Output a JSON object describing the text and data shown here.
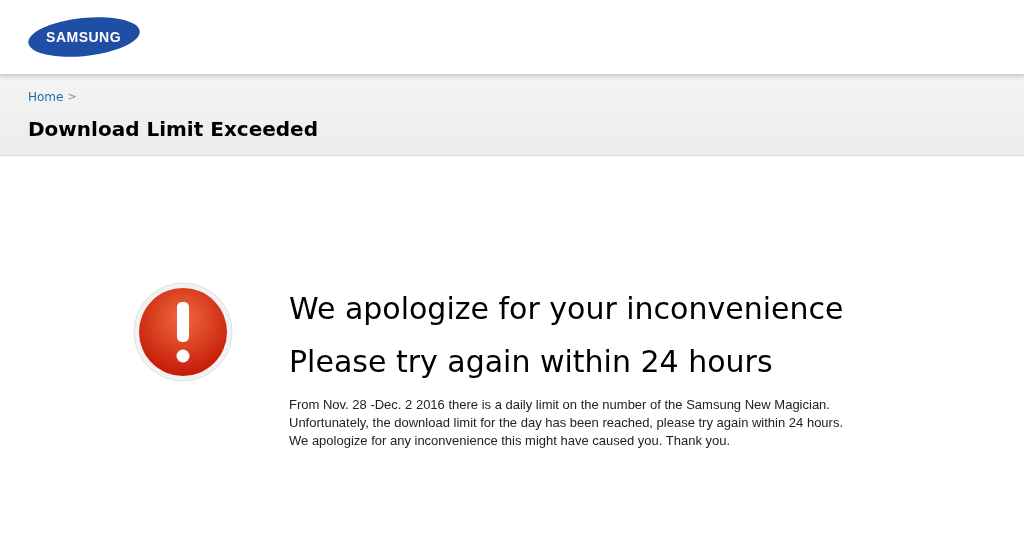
{
  "header": {
    "logo": "SAMSUNG"
  },
  "breadcrumb": [
    {
      "label": "Home",
      "separator": ">"
    }
  ],
  "page_title": "Download Limit Exceeded",
  "message": {
    "headings": [
      "We apologize for your inconvenience",
      "Please try again within 24 hours"
    ],
    "lines": [
      "From Nov. 28 -Dec. 2 2016 there is a daily limit on the number of the Samsung New Magician.",
      "Unfortunately, the download limit for the day has been reached, please try again within 24 hours.",
      "We apologize for any inconvenience this might have caused you. Thank you."
    ]
  }
}
